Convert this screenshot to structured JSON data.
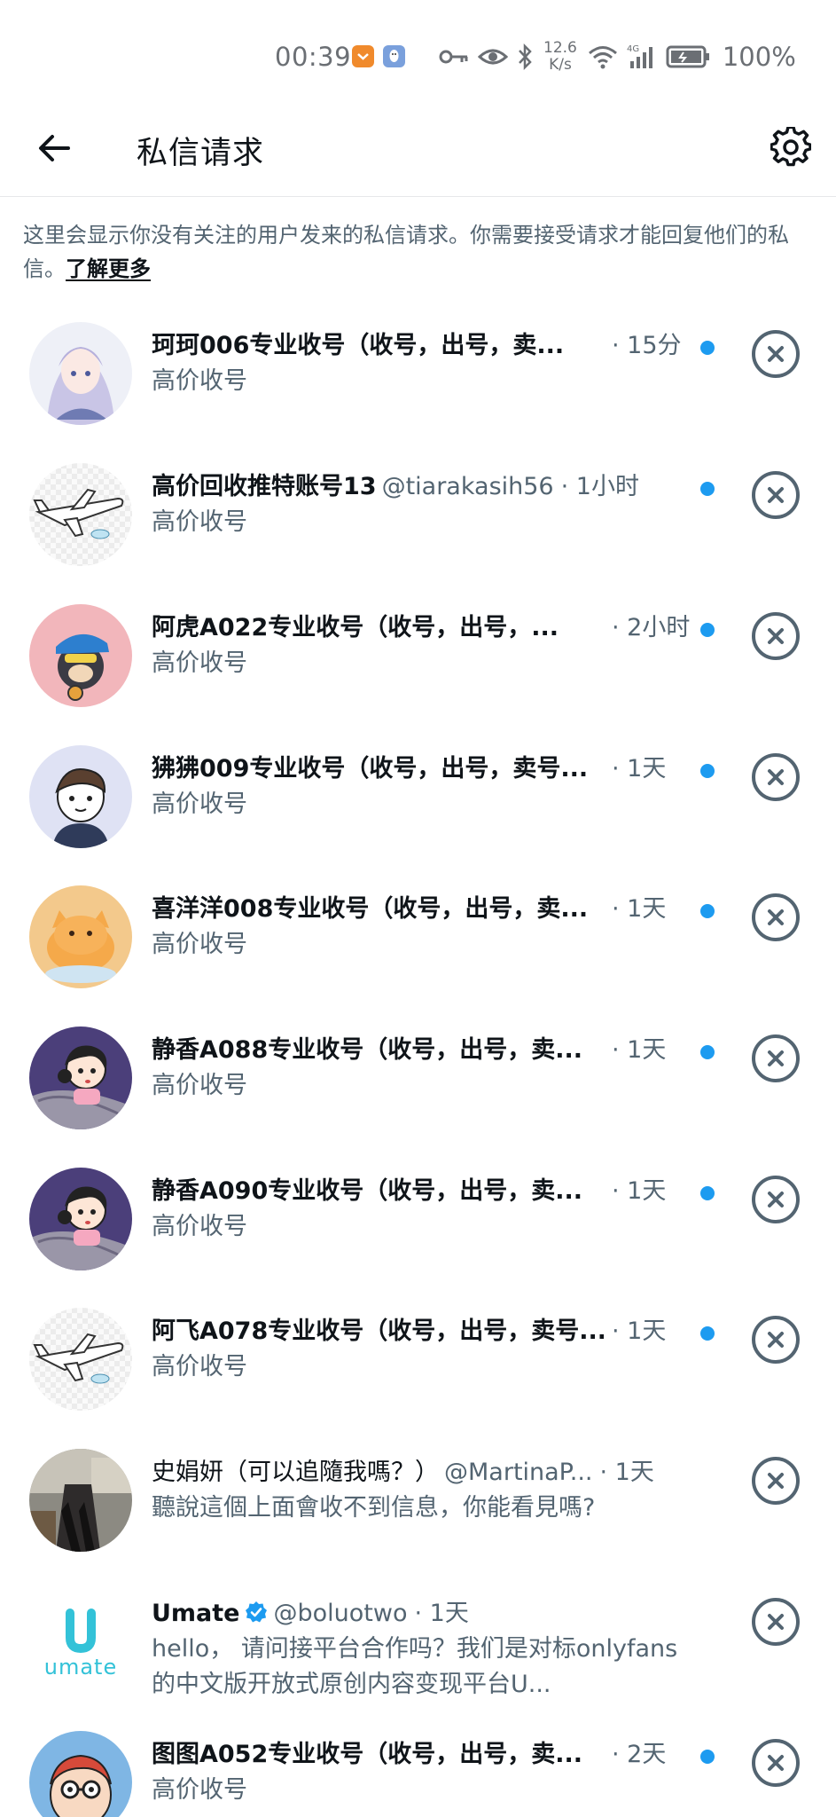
{
  "status_bar": {
    "time": "00:39",
    "net_speed_value": "12.6",
    "net_speed_unit": "K/s",
    "network_type": "4G",
    "battery": "100%"
  },
  "header": {
    "title": "私信请求"
  },
  "notice": {
    "text": "这里会显示你没有关注的用户发来的私信请求。你需要接受请求才能回复他们的私信。",
    "link": "了解更多"
  },
  "requests": [
    {
      "name": "珂珂006专业收号（收号，出号，卖...",
      "handle": "",
      "time": "· 15分",
      "message": "高价收号",
      "unread": true,
      "avatar": "anime-girl-avatar"
    },
    {
      "name": "高价回收推特账号13",
      "handle": "@tiarakasih56",
      "time": "· 1小时",
      "message": "高价收号",
      "unread": true,
      "avatar": "airplane-avatar"
    },
    {
      "name": "阿虎A022专业收号（收号，出号，...",
      "handle": "",
      "time": "· 2小时",
      "message": "高价收号",
      "unread": true,
      "avatar": "monkey-avatar"
    },
    {
      "name": "狒狒009专业收号（收号，出号，卖号...",
      "handle": "",
      "time": "· 1天",
      "message": "高价收号",
      "unread": true,
      "avatar": "boy-avatar"
    },
    {
      "name": "喜洋洋008专业收号（收号，出号，卖...",
      "handle": "",
      "time": "· 1天",
      "message": "高价收号",
      "unread": true,
      "avatar": "cat-avatar"
    },
    {
      "name": "静香A088专业收号（收号，出号，卖...",
      "handle": "",
      "time": "· 1天",
      "message": "高价收号",
      "unread": true,
      "avatar": "shizuka-avatar"
    },
    {
      "name": "静香A090专业收号（收号，出号，卖...",
      "handle": "",
      "time": "· 1天",
      "message": "高价收号",
      "unread": true,
      "avatar": "shizuka-avatar"
    },
    {
      "name": "阿飞A078专业收号（收号，出号，卖号...",
      "handle": "",
      "time": "· 1天",
      "message": "高价收号",
      "unread": true,
      "avatar": "airplane-avatar"
    },
    {
      "name": "史娟妍（可以追隨我嗎？）",
      "handle": "@MartinaP...",
      "time": "· 1天",
      "message": "聽說這個上面會收不到信息，你能看見嗎?",
      "unread": false,
      "avatar": "photo-avatar"
    },
    {
      "name": "Umate",
      "handle": "@boluotwo",
      "time": "· 1天",
      "message": "hello，  请问接平台合作吗？我们是对标onlyfans的中文版开放式原创内容变现平台U...",
      "unread": false,
      "avatar": "umate-logo-avatar",
      "verified": true
    },
    {
      "name": "图图A052专业收号（收号，出号，卖...",
      "handle": "",
      "time": "· 2天",
      "message": "高价收号",
      "unread": true,
      "avatar": "cartoon-glasses-avatar"
    }
  ],
  "colors": {
    "accent": "#1d9bf0",
    "text_primary": "#0f1419",
    "text_secondary": "#536471"
  }
}
